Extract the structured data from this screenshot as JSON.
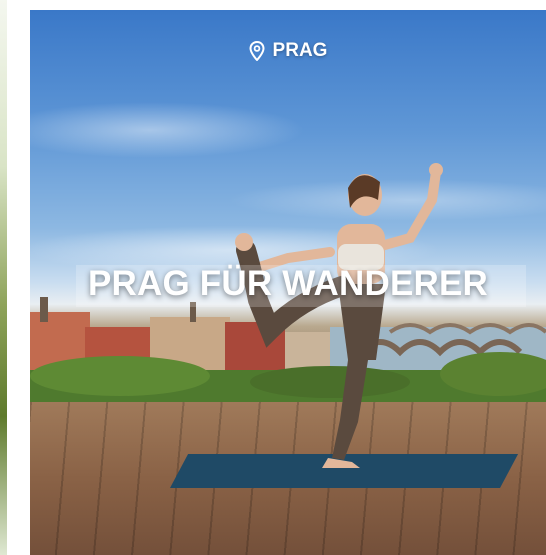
{
  "card": {
    "location_label": "PRAG",
    "location_icon": "map-pin-icon",
    "title": "PRAG FÜR WANDERER"
  },
  "colors": {
    "sky_top": "#3a78c8",
    "mat": "#1f4a66",
    "deck": "#8a6246",
    "text": "#ffffff"
  }
}
